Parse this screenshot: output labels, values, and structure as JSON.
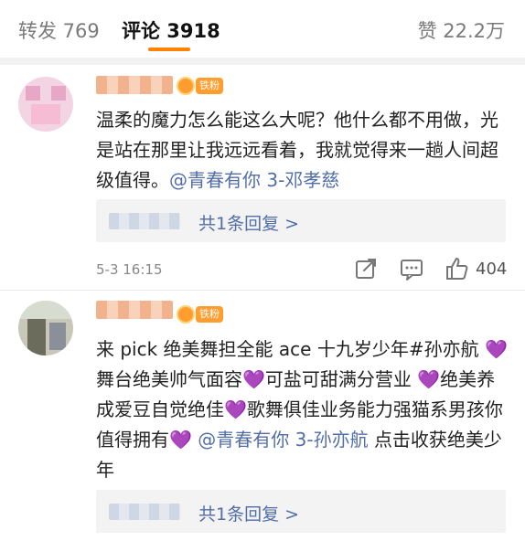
{
  "tabs": {
    "reposts": "转发 769",
    "comments": "评论 3918",
    "likes": "赞 22.2万"
  },
  "colors": {
    "accent_underline": "#ff8200",
    "link": "#526ea8",
    "badge": "#ff9d2e",
    "heart": "#8b3fd0"
  },
  "comments": [
    {
      "badge": "铁粉",
      "text_main": "温柔的魔力怎么能这么大呢？他什么都不用做，光是站在那里让我远远看着，我就觉得来一趟人间超级值得。",
      "mention": "@青春有你 3-邓孝慈",
      "reply_link": "共1条回复 >",
      "time": "5-3 16:15",
      "like_count": "404",
      "icons": [
        "share-icon",
        "comment-icon",
        "like-icon"
      ]
    },
    {
      "badge": "铁粉",
      "seg1": "来 pick 绝美舞担全能 ace 十九岁少年#孙亦航",
      "heart": "💜",
      "seg2": "舞台绝美帅气面容",
      "seg3": "可盐可甜满分营业",
      "seg4": "绝美养成爱豆自觉绝佳",
      "seg5": "歌舞俱佳业务能力强猫系男孩你值得拥有",
      "mention": "@青春有你 3-孙亦航",
      "tail": "点击收获绝美少年",
      "reply_link": "共1条回复 >"
    }
  ]
}
